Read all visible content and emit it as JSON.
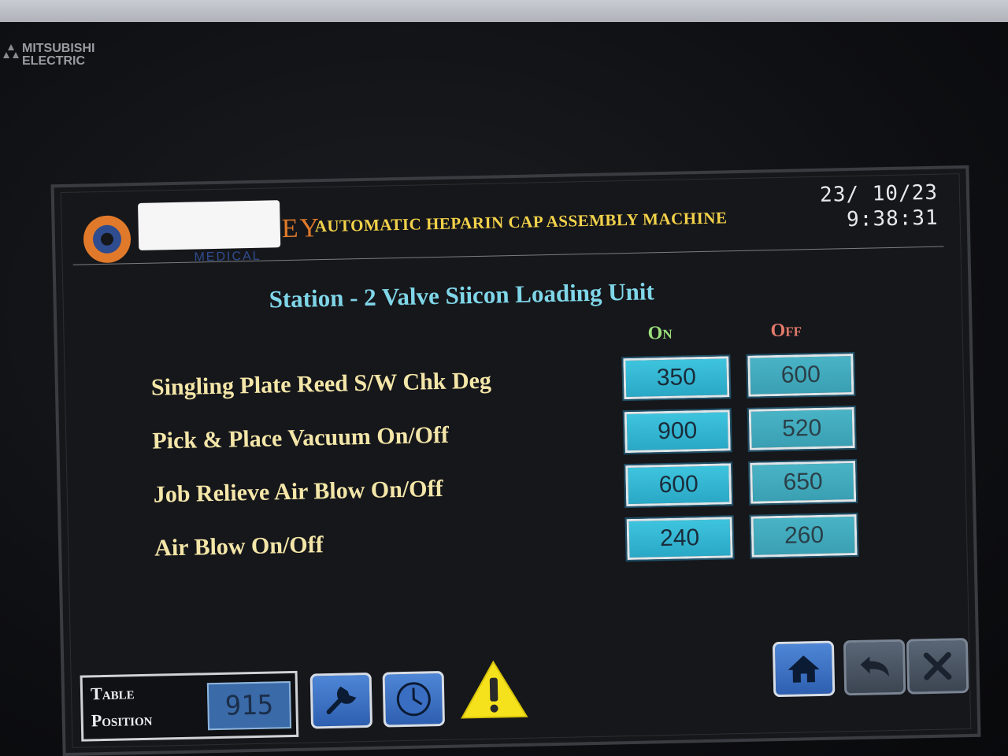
{
  "brand": {
    "line1": "MITSUBISHI",
    "line2": "ELECTRIC"
  },
  "header": {
    "logo_tail": "EY",
    "logo_sub": "MEDICAL",
    "title": "AUTOMATIC HEPARIN CAP ASSEMBLY MACHINE",
    "date": "23/ 10/23",
    "time": "9:38:31"
  },
  "screen": {
    "subtitle": "Station - 2 Valve Siicon Loading Unit",
    "col_on": "On",
    "col_off": "Off",
    "rows": [
      {
        "label": "Singling Plate Reed S/W Chk Deg",
        "on": "350",
        "off": "600"
      },
      {
        "label": "Pick & Place Vacuum On/Off",
        "on": "900",
        "off": "520"
      },
      {
        "label": "Job Relieve Air Blow On/Off",
        "on": "600",
        "off": "650"
      },
      {
        "label": "Air Blow On/Off",
        "on": "240",
        "off": "260"
      }
    ]
  },
  "footer": {
    "table_label_1": "Table",
    "table_label_2": "Position",
    "table_value": "915",
    "icons": [
      "wrench-icon",
      "clock-icon",
      "warning-icon",
      "home-icon",
      "back-icon",
      "close-icon"
    ]
  },
  "colors": {
    "title": "#f3d24a",
    "subtitle": "#7fd6e8",
    "label": "#f4e6a8",
    "on": "#9be07a",
    "off": "#e27a6c",
    "value_box": "#3ec4de"
  }
}
